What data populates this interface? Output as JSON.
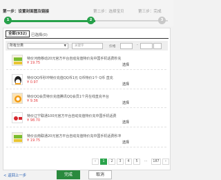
{
  "steps": [
    {
      "label": "第一步：设置封面图及链接",
      "num": "1"
    },
    {
      "label": "第二步：选择宝贝",
      "num": "2"
    },
    {
      "label": "第三步：完成",
      "num": "3"
    }
  ],
  "tabs": {
    "all": "全部(932)",
    "selected": "已选择(0)"
  },
  "filter": {
    "category": "所有分类",
    "keyword_placeholder": "关键字",
    "price_label": "价格",
    "dash": "-"
  },
  "items": [
    {
      "title": "特价河南移动20元官方平台自动充值特价充中国手机话费秒充",
      "price": "¥ 19.75",
      "action": "选择"
    },
    {
      "title": "特价QQ币秒冲特价充值QQ币1元 Q币特价1个 Q币 直充",
      "price": "¥ 0.97",
      "action": "选择"
    },
    {
      "title": "特价QQ会员特价充值腾讯QQ会员1个月在线直充平台",
      "price": "¥ 9.36",
      "action": "选择"
    },
    {
      "title": "特价辽宁联通100元官方平台自动充值特价充中国手机话费",
      "price": "¥ 98.70",
      "action": "选择"
    },
    {
      "title": "特价云南联通20元官方平台自动充值特价充中国手机话费秒冲",
      "price": "¥ 19.75",
      "action": "选择"
    }
  ],
  "pager": {
    "prev": "‹",
    "pages": [
      "1",
      "2",
      "3",
      "4",
      "5"
    ],
    "ellipsis": "...",
    "last": "187",
    "next": "›"
  },
  "footer": {
    "back": "< 返回上一步",
    "done": "完成",
    "cancel": "取消"
  }
}
